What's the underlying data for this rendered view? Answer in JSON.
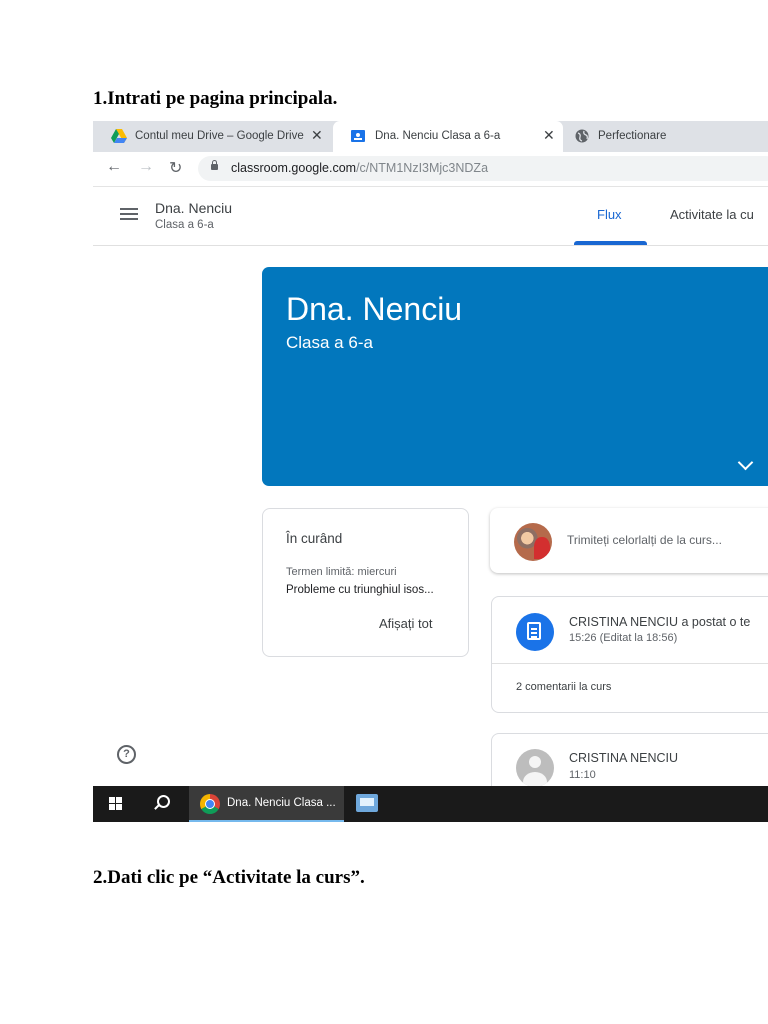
{
  "document": {
    "step1": "1.Intrati pe pagina principala.",
    "step2": "2.Dati clic pe “Activitate la curs”."
  },
  "browser": {
    "tabs": [
      {
        "label": "Contul meu Drive – Google Drive",
        "icon": "google-drive-icon",
        "active": false
      },
      {
        "label": "Dna. Nenciu Clasa a 6-a",
        "icon": "classroom-icon",
        "active": true
      },
      {
        "label": "Perfectionare",
        "icon": "globe-icon",
        "active": false
      }
    ],
    "url_domain": "classroom.google.com",
    "url_path": "/c/NTM1NzI3Mjc3NDZa"
  },
  "classroom": {
    "class_name": "Dna. Nenciu",
    "section": "Clasa a 6-a",
    "nav_tabs": [
      "Flux",
      "Activitate la cu"
    ],
    "banner_title": "Dna. Nenciu",
    "banner_subtitle": "Clasa a 6-a",
    "banner_color": "#0277bd",
    "upcoming": {
      "title": "În curând",
      "due": "Termen limită: miercuri",
      "item": "Probleme cu triunghiul isos...",
      "view_all": "Afișați tot"
    },
    "share_placeholder": "Trimiteți celorlalți de la curs...",
    "post": {
      "title": "CRISTINA NENCIU a postat o te",
      "time": "15:26 (Editat la 18:56)",
      "comments": "2 comentarii la curs"
    },
    "post2": {
      "author": "CRISTINA NENCIU",
      "time": "11:10"
    },
    "accent": "#1967d2"
  },
  "taskbar": {
    "app_label": "Dna. Nenciu Clasa ..."
  }
}
